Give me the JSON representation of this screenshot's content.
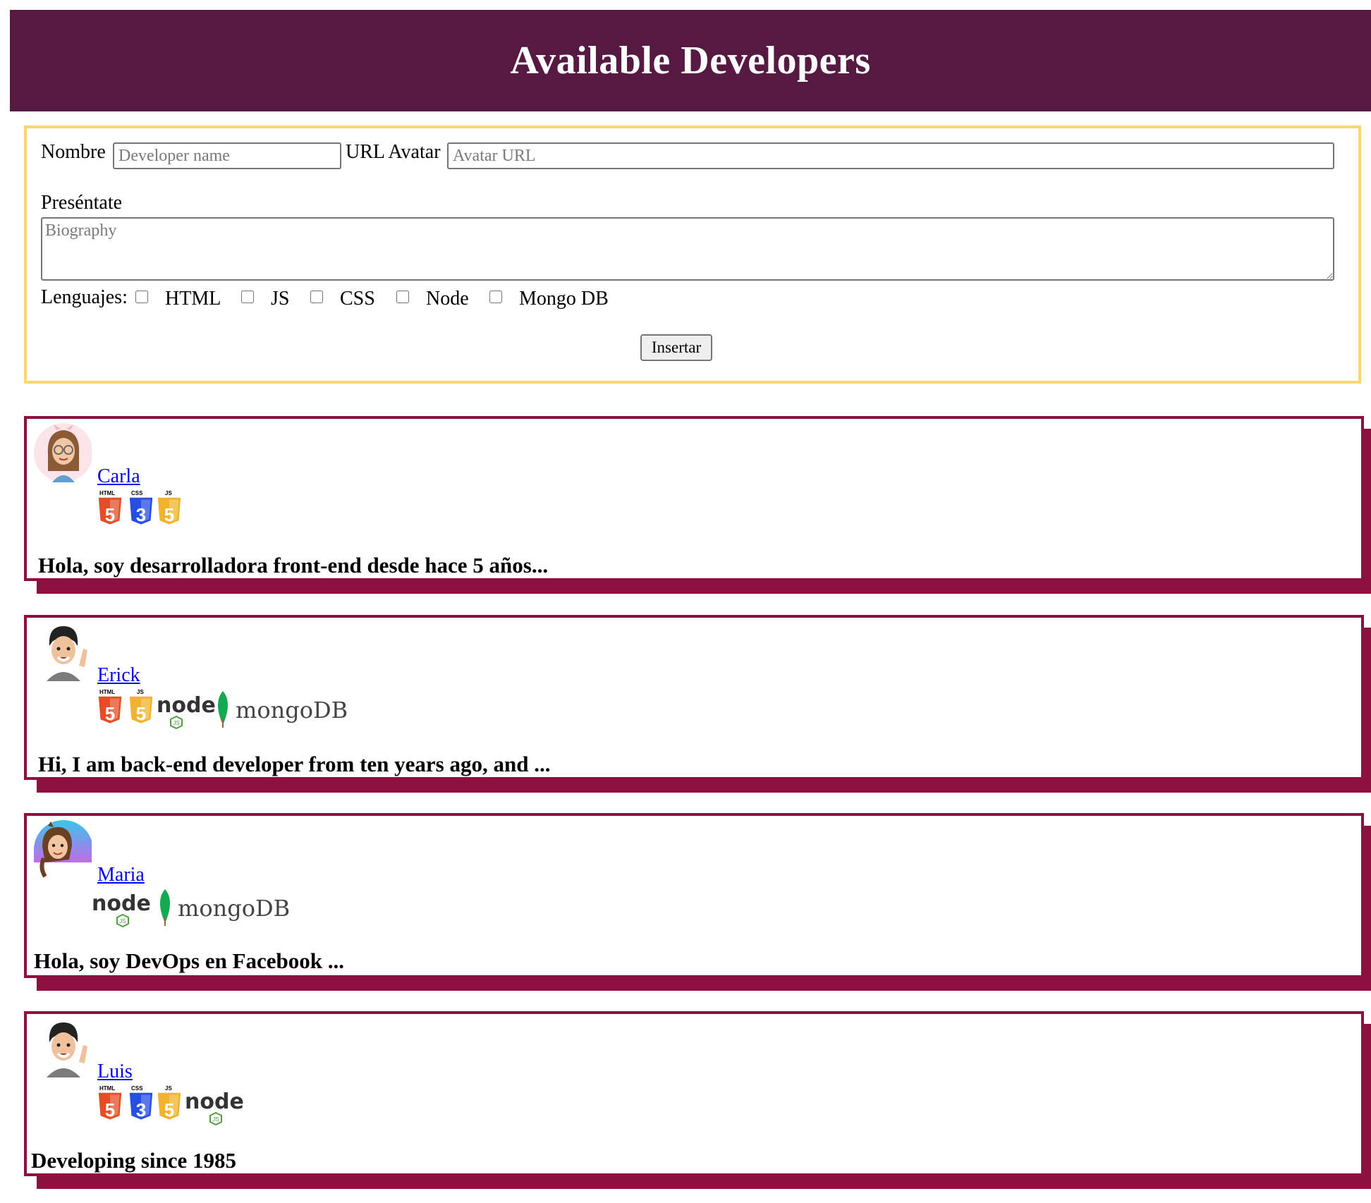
{
  "header": {
    "title": "Available Developers"
  },
  "form": {
    "name_label": "Nombre",
    "name_placeholder": "Developer name",
    "avatar_label": "URL Avatar",
    "avatar_placeholder": "Avatar URL",
    "bio_label": "Preséntate",
    "bio_placeholder": "Biography",
    "languages_label": "Lenguajes:",
    "languages": [
      "HTML",
      "JS",
      "CSS",
      "Node",
      "Mongo DB"
    ],
    "submit_label": "Insertar"
  },
  "developers": [
    {
      "name": "Carla",
      "bio": "Hola, soy desarrolladora front-end desde hace 5 años...",
      "skills": [
        "html5-logo",
        "css3-logo",
        "js-logo"
      ]
    },
    {
      "name": "Erick",
      "bio": "Hi, I am back-end developer from ten years ago, and ...",
      "skills": [
        "html5-logo",
        "js-logo",
        "nodejs-logo",
        "mongodb-logo"
      ]
    },
    {
      "name": "Maria",
      "bio": "Hola, soy DevOps en Facebook ...",
      "skills": [
        "nodejs-logo",
        "mongodb-logo"
      ]
    },
    {
      "name": "Luis",
      "bio": "Developing since 1985",
      "skills": [
        "html5-logo",
        "css3-logo",
        "js-logo",
        "nodejs-logo"
      ]
    }
  ],
  "logo_text": {
    "html": "HTML",
    "css": "CSS",
    "js": "JS",
    "node": "node",
    "node_badge": "JS",
    "mongo": "mongoDB"
  },
  "colors": {
    "header_bg": "#561942",
    "form_border": "#fcd673",
    "card_border": "#8d1040",
    "html5": "#e44d26",
    "css3": "#264de4",
    "js": "#f0b32b",
    "node": "#539e43",
    "mongo_leaf": "#13aa52"
  }
}
